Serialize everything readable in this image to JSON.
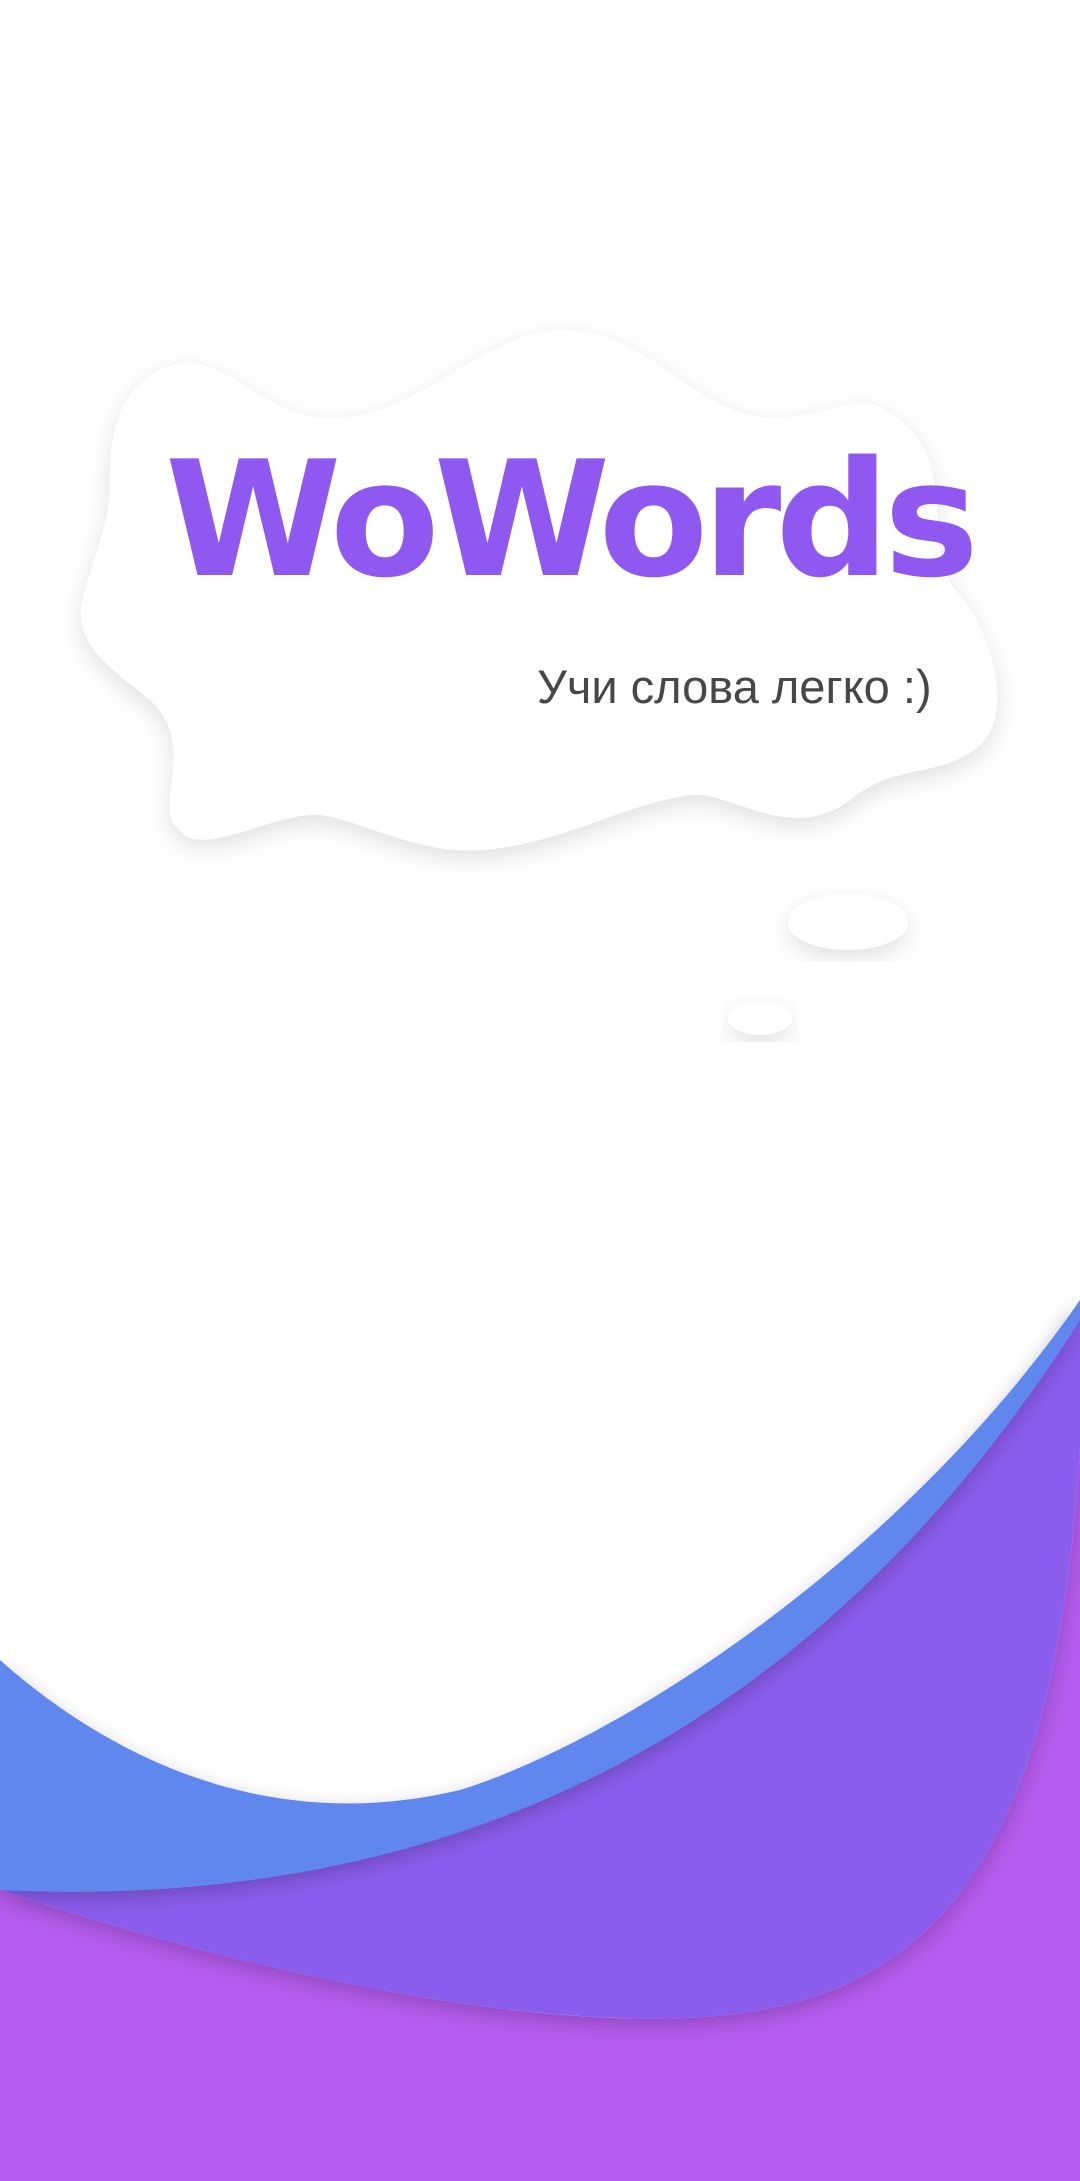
{
  "app": {
    "title": "WoWords",
    "tagline": "Учи слова легко :)"
  },
  "colors": {
    "title": "#8f58f0",
    "tagline": "#474747",
    "wave_blue": "#6087ee",
    "wave_violet": "#8b5ded",
    "wave_magenta": "#b65cf0",
    "background": "#ffffff"
  },
  "decorations": {
    "cloud": "thought-bubble",
    "waves": "layered-waves"
  }
}
